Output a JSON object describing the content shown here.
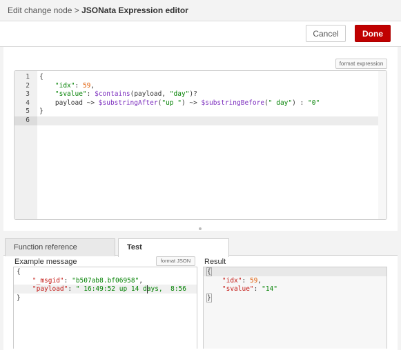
{
  "header": {
    "breadcrumb_prev": "Edit change node",
    "separator": ">",
    "title": "JSONata Expression editor"
  },
  "toolbar": {
    "cancel_label": "Cancel",
    "done_label": "Done"
  },
  "expression_editor": {
    "format_label": "format expression",
    "line_numbers": [
      "1",
      "2",
      "3",
      "4",
      "5",
      "6"
    ],
    "lines": [
      [
        "{"
      ],
      [
        "    ",
        "\"idx\"",
        ": ",
        "59",
        ","
      ],
      [
        "    ",
        "\"svalue\"",
        ": ",
        "$contains",
        "(payload, ",
        "\"day\"",
        ")?"
      ],
      [
        "    payload ~> ",
        "$substringAfter",
        "(",
        "\"up \"",
        ") ~> ",
        "$substringBefore",
        "(",
        "\" day\"",
        ") : ",
        "\"0\""
      ],
      [
        "}"
      ],
      [
        ""
      ]
    ]
  },
  "tabs": {
    "function_reference": "Function reference",
    "test": "Test"
  },
  "example_message": {
    "label": "Example message",
    "format_label": "format JSON",
    "lines": [
      "{",
      "    \"_msgid\": \"b507ab8.bf06958\",",
      "    \"payload\": \" 16:49:52 up 14 days,  8:56",
      "}"
    ],
    "key_msgid": "\"_msgid\"",
    "val_msgid": "\"b507ab8.bf06958\"",
    "key_payload": "\"payload\"",
    "val_payload": "\" 16:49:52 up 14 days,  8:56"
  },
  "result": {
    "label": "Result",
    "open_brace": "{",
    "key_idx": "\"idx\"",
    "val_idx": "59",
    "key_svalue": "\"svalue\"",
    "val_svalue": "\"14\"",
    "close_brace": "}"
  },
  "colors": {
    "done_button": "#c00000",
    "string": "#008000",
    "number": "#e05a00",
    "function": "#7a2bbd",
    "key_red": "#c41a16"
  }
}
